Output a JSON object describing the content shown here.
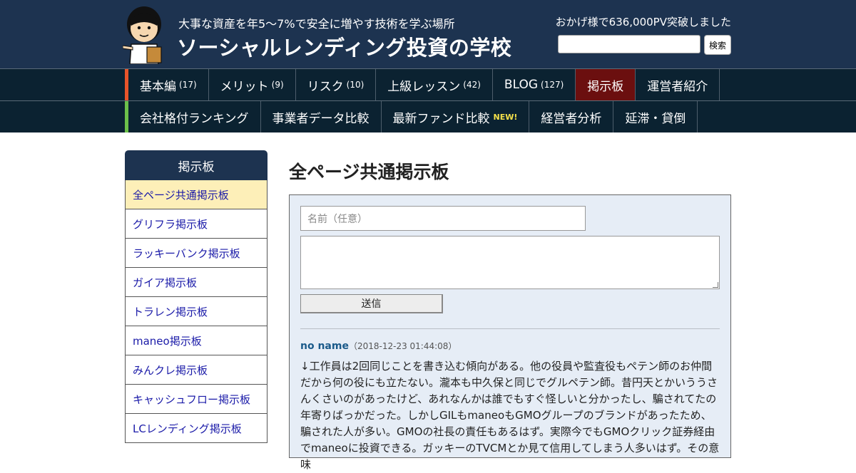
{
  "header": {
    "tagline": "大事な資産を年5～7%で安全に増やす技術を学ぶ場所",
    "site_title": "ソーシャルレンディング投資の学校",
    "pv_text": "おかげ様で636,000PV突破しました",
    "search_button": "検索",
    "mascot_icon": "teacher-mascot-icon"
  },
  "nav_primary": [
    {
      "label": "基本編",
      "count": "(17)"
    },
    {
      "label": "メリット",
      "count": "(9)"
    },
    {
      "label": "リスク",
      "count": "(10)"
    },
    {
      "label": "上級レッスン",
      "count": "(42)"
    },
    {
      "label": "BLOG",
      "count": "(127)"
    },
    {
      "label": "掲示板",
      "count": ""
    },
    {
      "label": "運営者紹介",
      "count": ""
    }
  ],
  "nav_secondary": [
    {
      "label": "会社格付ランキング",
      "badge": ""
    },
    {
      "label": "事業者データ比較",
      "badge": ""
    },
    {
      "label": "最新ファンド比較",
      "badge": "NEW!"
    },
    {
      "label": "経営者分析",
      "badge": ""
    },
    {
      "label": "延滞・貸倒",
      "badge": ""
    }
  ],
  "sidebar": {
    "title": "掲示板",
    "items": [
      "全ページ共通掲示板",
      "グリフラ掲示板",
      "ラッキーバンク掲示板",
      "ガイア掲示板",
      "トラレン掲示板",
      "maneo掲示板",
      "みんクレ掲示板",
      "キャッシュフロー掲示板",
      "LCレンディング掲示板"
    ]
  },
  "main": {
    "title": "全ページ共通掲示板",
    "name_placeholder": "名前（任意）",
    "send_label": "送信",
    "post": {
      "author": "no name",
      "timestamp": "（2018-12-23 01:44:08）",
      "body": "↓工作員は2回同じことを書き込む傾向がある。他の役員や監査役もペテン師のお仲間だから何の役にも立たない。瀧本も中久保と同じでグルペテン師。昔円天とかいううさんくさいのがあったけど、あれなんかは誰でもすぐ怪しいと分かったし、騙されてたの年寄りばっかだった。しかしGILもmaneoもGMOグループのブランドがあったため、騙された人が多い。GMOの社長の責任もあるはず。実際今でもGMOクリック証券経由でmaneoに投資できる。ガッキーのTVCMとか見て信用してしまう人多いはず。その意味"
    }
  },
  "colors": {
    "header_bg": "#1d3350",
    "nav_bg": "#0b2231",
    "nav_active": "#6b0f0f",
    "nav1_accent": "#e8542a",
    "nav2_accent": "#6cc04a",
    "sidebar_active": "#fdefb8",
    "board_bg": "#e6edf6",
    "link": "#1a1aa8"
  }
}
